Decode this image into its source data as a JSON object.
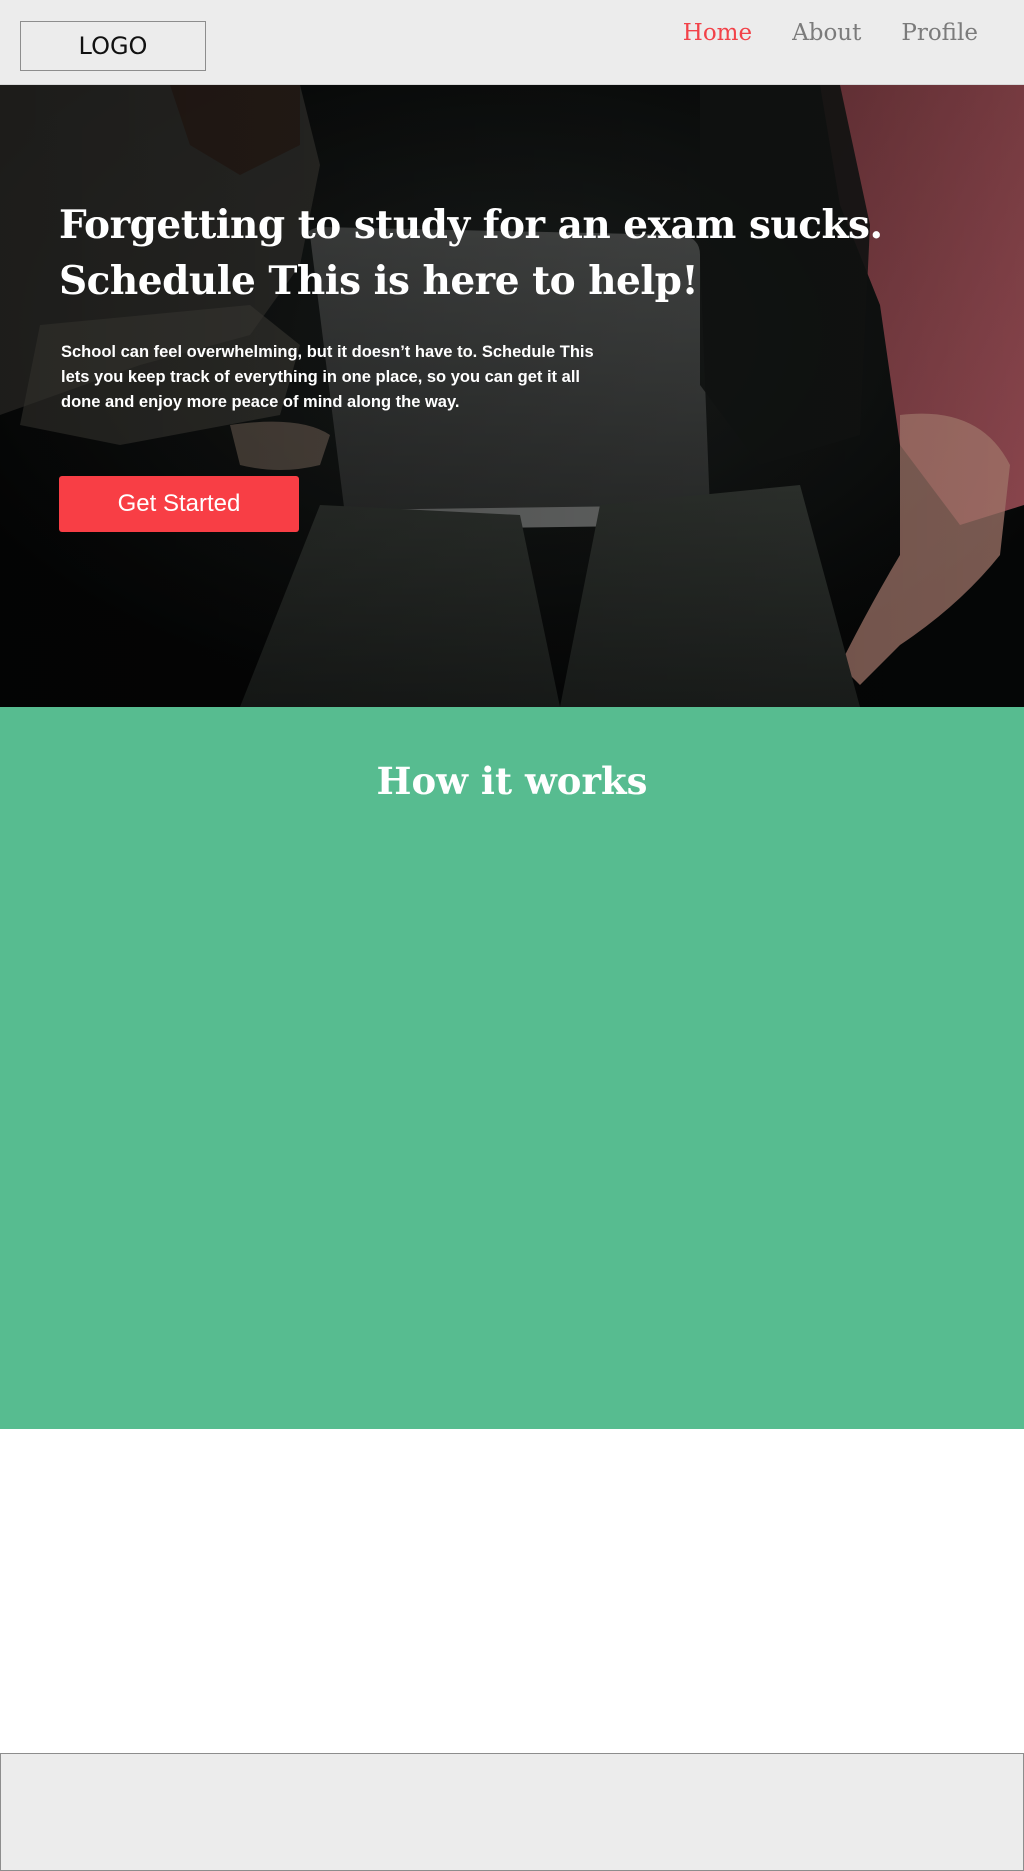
{
  "header": {
    "logo": "LOGO",
    "nav": [
      {
        "label": "Home",
        "active": true
      },
      {
        "label": "About",
        "active": false
      },
      {
        "label": "Profile",
        "active": false
      }
    ]
  },
  "hero": {
    "title_line_1": "Forgetting to study for an exam sucks.",
    "title_line_2": "Schedule This is here to help!",
    "text": "School can feel overwhelming, but it doesn’t have to. Schedule This lets you keep track of everything in one place, so you can get it all done and enjoy more peace of mind along the way.",
    "cta_label": "Get Started"
  },
  "how_it_works": {
    "title": "How it works"
  },
  "colors": {
    "accent": "#f83e45",
    "nav_active": "#f24249",
    "nav_inactive": "#7b7b7b",
    "section_green": "#57bc90",
    "header_bg": "#ececec"
  },
  "icons": {
    "hero_photo": "students-with-laptop-photo"
  }
}
